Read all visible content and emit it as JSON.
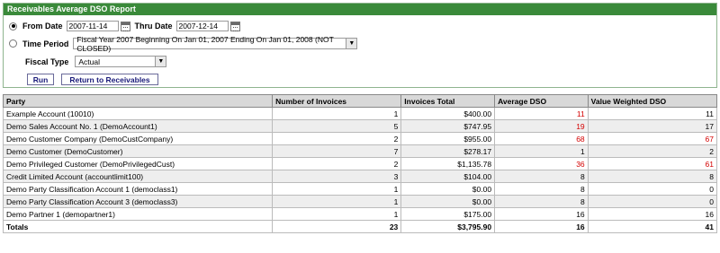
{
  "panel": {
    "title": "Receivables Average DSO Report"
  },
  "form": {
    "from_date_label": "From Date",
    "from_date_value": "2007-11-14",
    "thru_date_label": "Thru Date",
    "thru_date_value": "2007-12-14",
    "time_period_label": "Time Period",
    "time_period_value": "Fiscal Year 2007 Beginning On Jan 01, 2007 Ending On Jan 01, 2008 (NOT CLOSED)",
    "fiscal_type_label": "Fiscal Type",
    "fiscal_type_value": "Actual",
    "run_label": "Run",
    "return_label": "Return to Receivables"
  },
  "table": {
    "headers": [
      "Party",
      "Number of Invoices",
      "Invoices Total",
      "Average DSO",
      "Value Weighted DSO"
    ],
    "rows": [
      {
        "party": "Example Account (10010)",
        "invoices": "1",
        "total": "$400.00",
        "avg_dso": "11",
        "wdso": "11"
      },
      {
        "party": "Demo Sales Account No. 1 (DemoAccount1)",
        "invoices": "5",
        "total": "$747.95",
        "avg_dso": "19",
        "wdso": "17"
      },
      {
        "party": "Demo Customer Company (DemoCustCompany)",
        "invoices": "2",
        "total": "$955.00",
        "avg_dso": "68",
        "wdso": "67"
      },
      {
        "party": "Demo Customer (DemoCustomer)",
        "invoices": "7",
        "total": "$278.17",
        "avg_dso": "1",
        "wdso": "2"
      },
      {
        "party": "Demo Privileged Customer (DemoPrivilegedCust)",
        "invoices": "2",
        "total": "$1,135.78",
        "avg_dso": "36",
        "wdso": "61"
      },
      {
        "party": "Credit Limited Account (accountlimit100)",
        "invoices": "3",
        "total": "$104.00",
        "avg_dso": "8",
        "wdso": "8"
      },
      {
        "party": "Demo Party Classification Account 1 (democlass1)",
        "invoices": "1",
        "total": "$0.00",
        "avg_dso": "8",
        "wdso": "0"
      },
      {
        "party": "Demo Party Classification Account 3 (democlass3)",
        "invoices": "1",
        "total": "$0.00",
        "avg_dso": "8",
        "wdso": "0"
      },
      {
        "party": "Demo Partner 1 (demopartner1)",
        "invoices": "1",
        "total": "$175.00",
        "avg_dso": "16",
        "wdso": "16"
      }
    ],
    "totals": {
      "label": "Totals",
      "invoices": "23",
      "total": "$3,795.90",
      "avg_dso": "16",
      "wdso": "41"
    }
  },
  "colors": {
    "header_green": "#3a8a3a",
    "warning_red": "#d40000"
  }
}
